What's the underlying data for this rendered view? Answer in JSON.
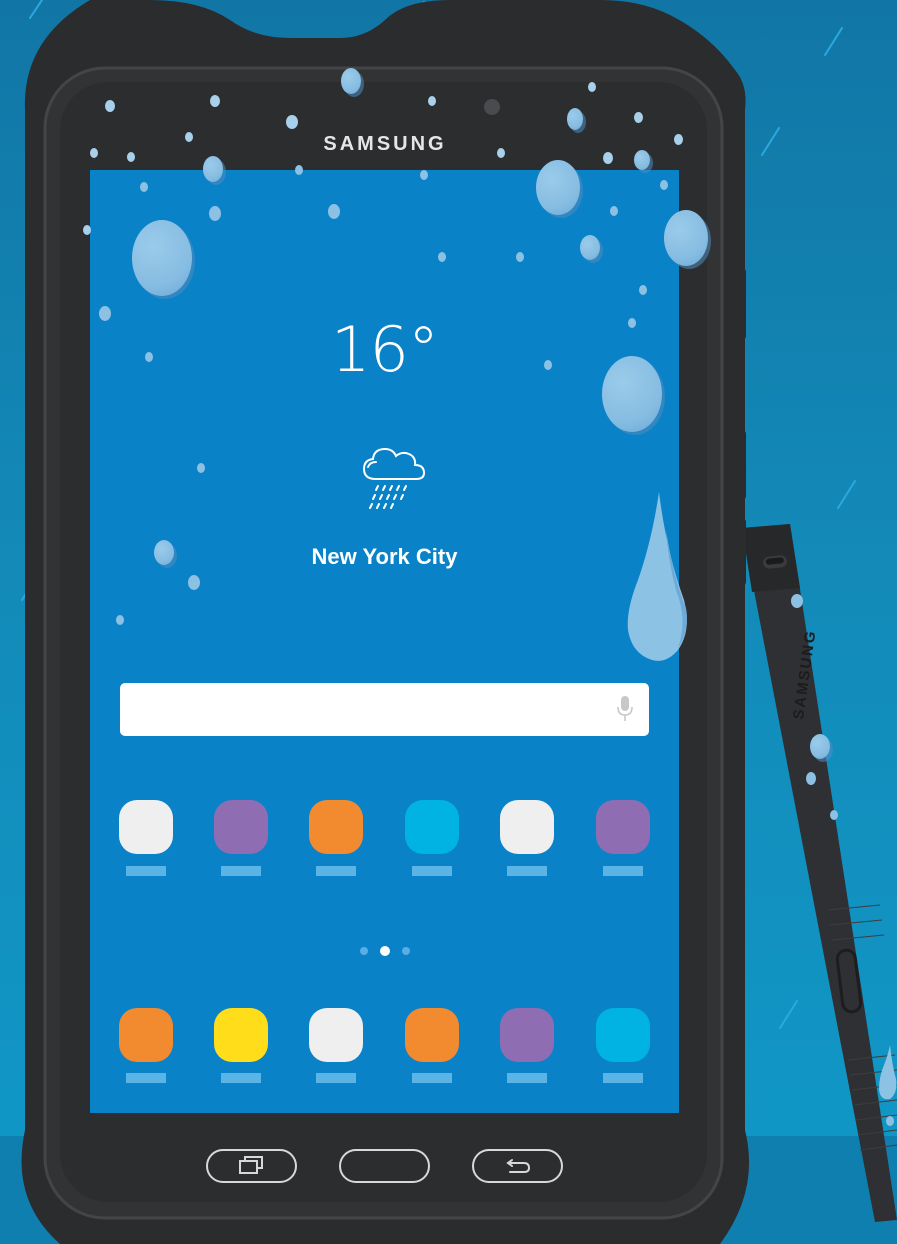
{
  "scene": {
    "background_colors": [
      "#1176a6",
      "#1099c8"
    ],
    "device_brand": "SAMSUNG",
    "stylus_brand": "SAMSUNG"
  },
  "screen": {
    "background_color": "#0a82c8",
    "weather": {
      "temperature": "16°",
      "condition_icon": "cloud-rain-icon",
      "city": "New York City"
    },
    "search": {
      "icon": "mic-icon"
    },
    "apps_row_1": [
      {
        "color": "#efefef"
      },
      {
        "color": "#8f6db3"
      },
      {
        "color": "#f28a30"
      },
      {
        "color": "#00b3e3"
      },
      {
        "color": "#efefef"
      },
      {
        "color": "#8f6db3"
      }
    ],
    "page_indicator": {
      "total": 3,
      "active": 2
    },
    "apps_row_2": [
      {
        "color": "#f28a30"
      },
      {
        "color": "#ffdd1a"
      },
      {
        "color": "#efefef"
      },
      {
        "color": "#f28a30"
      },
      {
        "color": "#8f6db3"
      },
      {
        "color": "#00b3e3"
      }
    ]
  },
  "nav_buttons": [
    {
      "icon": "recent-apps-icon"
    },
    {
      "icon": "home-button"
    },
    {
      "icon": "back-icon"
    }
  ]
}
